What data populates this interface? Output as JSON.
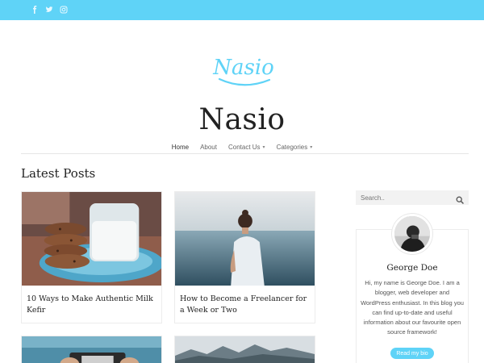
{
  "topbar": {
    "social": [
      {
        "name": "facebook-icon"
      },
      {
        "name": "twitter-icon"
      },
      {
        "name": "instagram-icon"
      }
    ]
  },
  "site": {
    "logo_text": "Nasio",
    "title": "Nasio"
  },
  "nav": {
    "items": [
      {
        "label": "Home",
        "active": true,
        "dropdown": false
      },
      {
        "label": "About",
        "active": false,
        "dropdown": false
      },
      {
        "label": "Contact Us",
        "active": false,
        "dropdown": true
      },
      {
        "label": "Categories",
        "active": false,
        "dropdown": true
      }
    ]
  },
  "main": {
    "section_title": "Latest Posts",
    "posts": [
      {
        "title": "10 Ways to Make Authentic Milk Kefir"
      },
      {
        "title": "How to Become a Freelancer for a Week or Two"
      },
      {
        "title": ""
      },
      {
        "title": ""
      }
    ]
  },
  "sidebar": {
    "search_placeholder": "Search..",
    "author": {
      "name": "George Doe",
      "bio": "Hi, my name is George Doe. I am a blogger, web developer and WordPress enthusiast. In this blog you can find up-to-date and useful information about our favourite open source framework!",
      "button_label": "Read my bio"
    }
  },
  "colors": {
    "accent": "#5fd3f7",
    "text_dark": "#222222"
  }
}
